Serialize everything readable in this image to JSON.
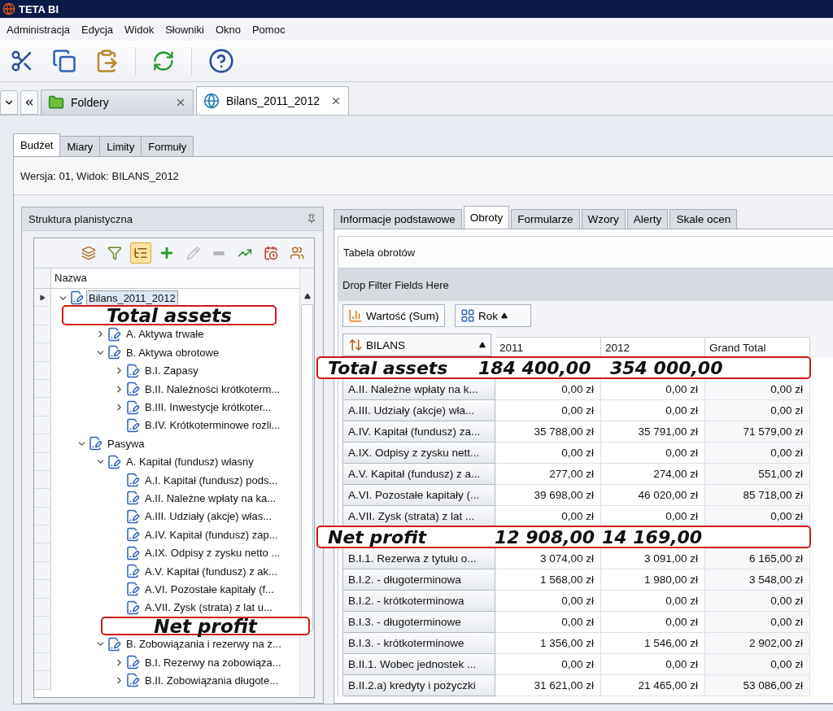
{
  "window": {
    "title": "TETA BI"
  },
  "menu": [
    "Administracja",
    "Edycja",
    "Widok",
    "Słowniki",
    "Okno",
    "Pomoc"
  ],
  "doc_tabs": [
    {
      "label": "Foldery",
      "selected": false
    },
    {
      "label": "Bilans_2011_2012",
      "selected": true
    }
  ],
  "view_tabs": [
    {
      "label": "Budżet",
      "selected": true
    },
    {
      "label": "Miary",
      "selected": false
    },
    {
      "label": "Limity",
      "selected": false
    },
    {
      "label": "Formuły",
      "selected": false
    }
  ],
  "version_label": "Wersja: 01, Widok: BILANS_2012",
  "structure_panel": {
    "title": "Struktura planistyczna",
    "layout_toggle_on": true,
    "edit_enabled": false,
    "remove_enabled": false,
    "column": "Nazwa",
    "tree": [
      {
        "label": "Bilans_2011_2012",
        "expanded": true,
        "selected": true,
        "children": [
          {
            "annotation": "Total assets",
            "expanded": true,
            "children": [
              {
                "label": "A. Aktywa trwałe",
                "expanded": false,
                "selected": false
              },
              {
                "label": "B. Aktywa obrotowe",
                "expanded": true,
                "selected": false,
                "children": [
                  {
                    "label": "B.I. Zapasy",
                    "expanded": false,
                    "selected": false
                  },
                  {
                    "label": "B.II. Należności krótkoterm...",
                    "expanded": false,
                    "selected": false
                  },
                  {
                    "label": "B.III. Inwestycje krótkoter...",
                    "expanded": false,
                    "selected": false
                  },
                  {
                    "label": "B.IV. Krótkoterminowe rozli...",
                    "selected": false
                  }
                ]
              }
            ]
          },
          {
            "label": "Pasywa",
            "expanded": true,
            "selected": false,
            "children": [
              {
                "label": "A. Kapitał (fundusz) własny",
                "expanded": true,
                "selected": false,
                "children": [
                  {
                    "label": "A.I. Kapitał (fundusz) pods...",
                    "selected": false
                  },
                  {
                    "label": "A.II. Należne wpłaty na ka...",
                    "selected": false
                  },
                  {
                    "label": "A.III. Udziały (akcje) włas...",
                    "selected": false
                  },
                  {
                    "label": "A.IV. Kapitał (fundusz) zap...",
                    "selected": false
                  },
                  {
                    "label": "A.IX. Odpisy z zysku netto ...",
                    "selected": false
                  },
                  {
                    "label": "A.V. Kapitał (fundusz) z ak...",
                    "selected": false
                  },
                  {
                    "label": "A.VI. Pozostałe kapitały (f...",
                    "selected": false
                  },
                  {
                    "label": "A.VII. Zysk (strata) z lat u...",
                    "selected": false
                  },
                  {
                    "annotation": "Net profit"
                  }
                ]
              },
              {
                "label": "B. Zobowiązania i rezerwy na z...",
                "expanded": true,
                "selected": false,
                "children": [
                  {
                    "label": "B.I. Rezerwy na zobowiąza...",
                    "expanded": false,
                    "selected": false
                  },
                  {
                    "label": "B.II. Zobowiązania długote...",
                    "expanded": false,
                    "selected": false
                  }
                ]
              }
            ]
          }
        ]
      }
    ]
  },
  "detail_tabs": [
    {
      "label": "Informacje podstawowe",
      "selected": false
    },
    {
      "label": "Obroty",
      "selected": true
    },
    {
      "label": "Formularze",
      "selected": false
    },
    {
      "label": "Wzory",
      "selected": false
    },
    {
      "label": "Alerty",
      "selected": false
    },
    {
      "label": "Skale ocen",
      "selected": false
    }
  ],
  "pivot": {
    "title": "Tabela obrotów",
    "filter_area": "Drop Filter Fields Here",
    "data_field": "Wartość (Sum)",
    "column_field": "Rok",
    "row_field": "BILANS",
    "columns": [
      "2011",
      "2012",
      "Grand Total"
    ],
    "rows": [
      {
        "kind": "annotation",
        "label": "Total assets",
        "values": [
          "184 400,00",
          "354 000,00"
        ]
      },
      {
        "kind": "data",
        "label": "A.II. Należne wpłaty na k...",
        "values": [
          "0,00 zł",
          "0,00 zł",
          "0,00 zł"
        ]
      },
      {
        "kind": "data",
        "label": "A.III. Udziały (akcje) wła...",
        "values": [
          "0,00 zł",
          "0,00 zł",
          "0,00 zł"
        ]
      },
      {
        "kind": "data",
        "label": "A.IV. Kapitał (fundusz) za...",
        "values": [
          "35 788,00 zł",
          "35 791,00 zł",
          "71 579,00 zł"
        ]
      },
      {
        "kind": "data",
        "label": "A.IX. Odpisy z zysku nett...",
        "values": [
          "0,00 zł",
          "0,00 zł",
          "0,00 zł"
        ]
      },
      {
        "kind": "data",
        "label": "A.V. Kapitał (fundusz) z a...",
        "values": [
          "277,00 zł",
          "274,00 zł",
          "551,00 zł"
        ]
      },
      {
        "kind": "data",
        "label": "A.VI. Pozostałe kapitały (...",
        "values": [
          "39 698,00 zł",
          "46 020,00 zł",
          "85 718,00 zł"
        ]
      },
      {
        "kind": "data",
        "label": "A.VII. Zysk (strata) z lat ...",
        "values": [
          "0,00 zł",
          "0,00 zł",
          "0,00 zł"
        ]
      },
      {
        "kind": "annotation",
        "label": "Net profit",
        "values": [
          "12 908,00",
          "14 169,00"
        ]
      },
      {
        "kind": "data",
        "label": "B.I.1. Rezerwa z tytułu o...",
        "values": [
          "3 074,00 zł",
          "3 091,00 zł",
          "6 165,00 zł"
        ]
      },
      {
        "kind": "data",
        "label": "B.I.2. - długoterminowa",
        "values": [
          "1 568,00 zł",
          "1 980,00 zł",
          "3 548,00 zł"
        ]
      },
      {
        "kind": "data",
        "label": "B.I.2. - krótkoterminowa",
        "values": [
          "0,00 zł",
          "0,00 zł",
          "0,00 zł"
        ]
      },
      {
        "kind": "data",
        "label": "B.I.3. - długoterminowe",
        "values": [
          "0,00 zł",
          "0,00 zł",
          "0,00 zł"
        ]
      },
      {
        "kind": "data",
        "label": "B.I.3. - krótkoterminowe",
        "values": [
          "1 356,00 zł",
          "1 546,00 zł",
          "2 902,00 zł"
        ]
      },
      {
        "kind": "data",
        "label": "B.II.1. Wobec jednostek ...",
        "values": [
          "0,00 zł",
          "0,00 zł",
          "0,00 zł"
        ]
      },
      {
        "kind": "data",
        "label": "B.II.2.a) kredyty i pożyczki",
        "values": [
          "31 621,00 zł",
          "21 465,00 zł",
          "53 086,00 zł"
        ]
      }
    ]
  }
}
